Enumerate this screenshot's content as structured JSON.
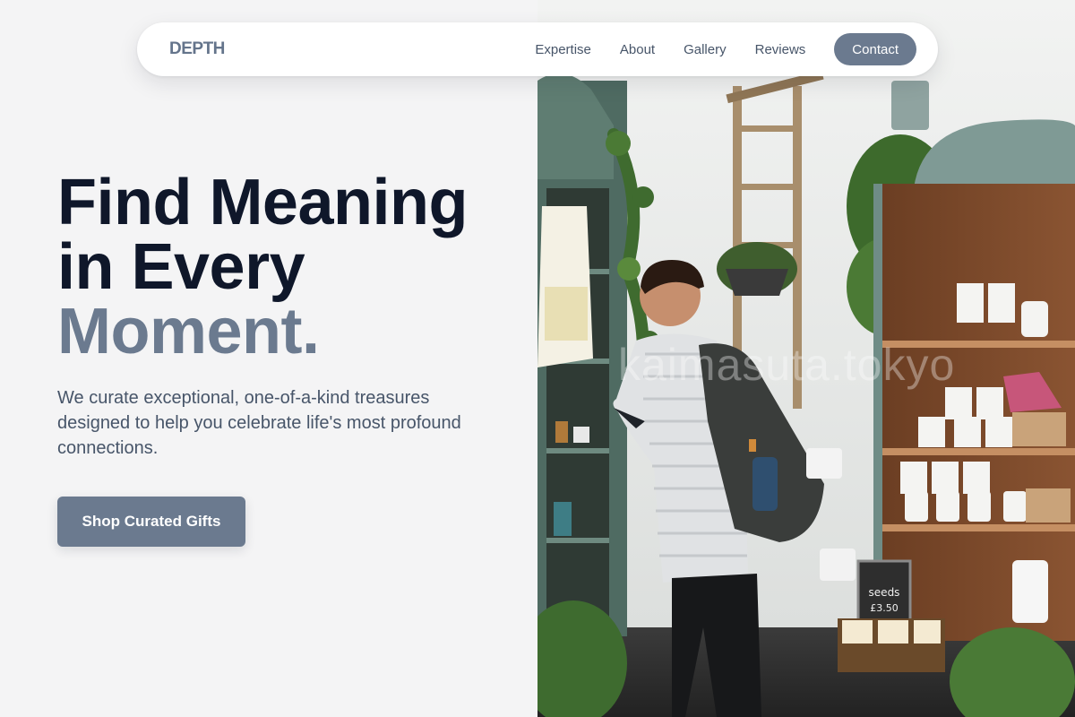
{
  "nav": {
    "brand": "DEPTH",
    "links": [
      "Expertise",
      "About",
      "Gallery",
      "Reviews"
    ],
    "contact_label": "Contact"
  },
  "hero": {
    "headline_line1": "Find Meaning",
    "headline_line2": "in Every",
    "headline_line3": "Moment.",
    "subtitle": "We curate exceptional, one-of-a-kind treasures designed to help you celebrate life's most profound connections.",
    "cta_label": "Shop Curated Gifts"
  },
  "image": {
    "watermark": "kaimasuta.tokyo",
    "jar_label": "seeds",
    "chalkboard_price": "£3.50"
  },
  "colors": {
    "headline_dark": "#0f172a",
    "accent_slate": "#6b7a8f",
    "body_text": "#475569",
    "background": "#f4f4f5"
  }
}
